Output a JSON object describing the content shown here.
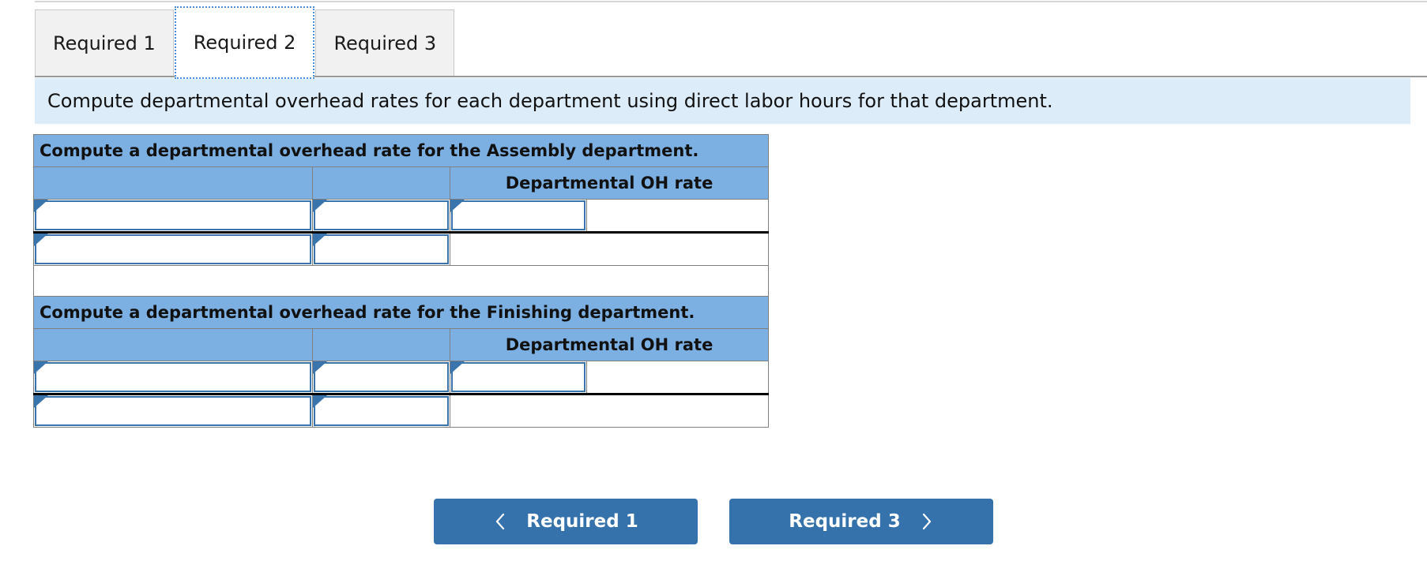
{
  "tabs": [
    {
      "label": "Required 1",
      "active": false
    },
    {
      "label": "Required 2",
      "active": true
    },
    {
      "label": "Required 3",
      "active": false
    }
  ],
  "instruction": {
    "text": "Compute departmental overhead rates for each department using direct labor hours for that department."
  },
  "worksheet": {
    "sections": [
      {
        "title": "Compute a departmental overhead rate for the Assembly department.",
        "column_headers": [
          "",
          "",
          "Departmental OH rate"
        ],
        "rows": [
          {
            "cells": [
              "",
              "",
              ""
            ],
            "inputs": [
              true,
              true,
              true
            ],
            "bottom_rule": true
          },
          {
            "cells": [
              "",
              "",
              ""
            ],
            "inputs": [
              true,
              true,
              false
            ],
            "bottom_rule": false
          }
        ]
      },
      {
        "title": "Compute a departmental overhead rate for the Finishing department.",
        "column_headers": [
          "",
          "",
          "Departmental OH rate"
        ],
        "rows": [
          {
            "cells": [
              "",
              "",
              ""
            ],
            "inputs": [
              true,
              true,
              true
            ],
            "bottom_rule": true
          },
          {
            "cells": [
              "",
              "",
              ""
            ],
            "inputs": [
              true,
              true,
              false
            ],
            "bottom_rule": false
          }
        ]
      }
    ]
  },
  "navigation": {
    "prev": {
      "label": "Required 1",
      "icon": "chevron-left-icon"
    },
    "next": {
      "label": "Required 3",
      "icon": "chevron-right-icon"
    }
  },
  "colors": {
    "header_blue": "#7cb0e3",
    "banner_blue": "#ddecf9",
    "button_blue": "#3572ac",
    "input_border": "#3a74ad",
    "grid_line": "#7f7f7f"
  }
}
